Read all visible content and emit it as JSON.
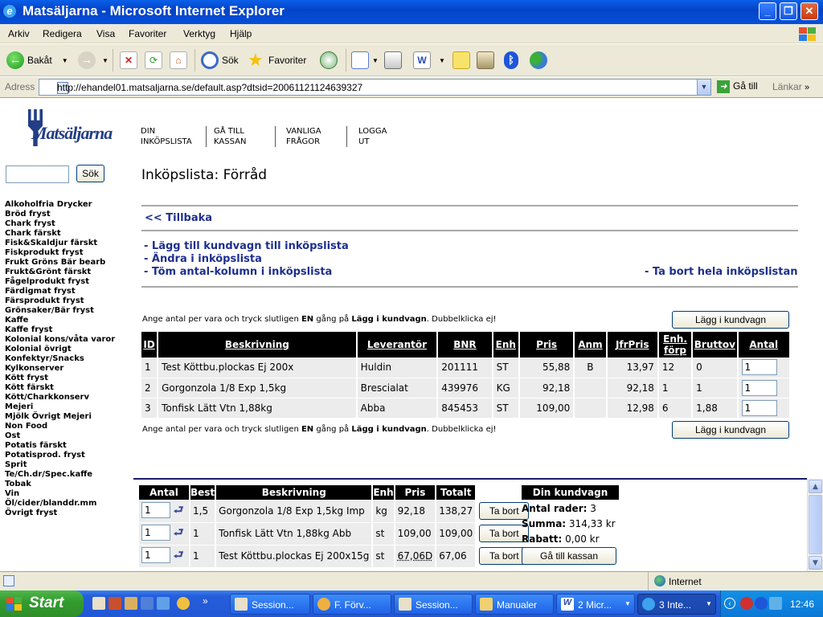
{
  "window": {
    "title": "Matsäljarna - Microsoft Internet Explorer",
    "min": "_",
    "max": "❐",
    "close": "✕"
  },
  "menu": [
    "Arkiv",
    "Redigera",
    "Visa",
    "Favoriter",
    "Verktyg",
    "Hjälp"
  ],
  "toolbar": {
    "back": "Bakåt",
    "search": "Sök",
    "favorites": "Favoriter"
  },
  "address": {
    "label": "Adress",
    "url": "http://ehandel01.matsaljarna.se/default.asp?dtsid=20061121124639327",
    "go": "Gå till",
    "links": "Länkar"
  },
  "site": {
    "logo": "Matsäljarna"
  },
  "topnav": [
    {
      "line1": "DIN",
      "line2": "INKÖPSLISTA"
    },
    {
      "line1": "GÅ TILL",
      "line2": "KASSAN"
    },
    {
      "line1": "VANLIGA",
      "line2": "FRÅGOR"
    },
    {
      "line1": "LOGGA",
      "line2": "UT"
    }
  ],
  "search": {
    "button": "Sök",
    "value": ""
  },
  "categories": [
    "Alkoholfria Drycker",
    "Bröd fryst",
    "Chark fryst",
    "Chark färskt",
    "Fisk&Skaldjur färskt",
    "Fiskprodukt fryst",
    "Frukt Gröns Bär bearb",
    "Frukt&Grönt färskt",
    "Fågelprodukt fryst",
    "Färdigmat fryst",
    "Färsprodukt fryst",
    "Grönsaker/Bär fryst",
    "Kaffe",
    "Kaffe fryst",
    "Kolonial kons/våta varor",
    "Kolonial övrigt",
    "Konfektyr/Snacks",
    "Kylkonserver",
    "Kött fryst",
    "Kött färskt",
    "Kött/Charkkonserv",
    "Mejeri",
    "Mjölk Övrigt Mejeri",
    "Non Food",
    "Ost",
    "Potatis färskt",
    "Potatisprod. fryst",
    "Sprit",
    "Te/Ch.dr/Spec.kaffe",
    "Tobak",
    "Vin",
    "Öl/cider/blanddr.mm",
    "Övrigt fryst"
  ],
  "main": {
    "heading": "Inköpslista: Förråd",
    "back": "<< Tillbaka",
    "actions": [
      "- Lägg till kundvagn till inköpslista",
      "- Ändra i inköpslista",
      "- Töm antal-kolumn i inköpslista"
    ],
    "delete_all": "- Ta bort hela inköpslistan",
    "instruction_pre": "Ange antal per vara och tryck slutligen",
    "instruction_en": "EN",
    "instruction_mid": "gång på",
    "instruction_btn": "Lägg i kundvagn",
    "instruction_post": ". Dubbelklicka ej!",
    "add_to_cart": "Lägg i kundvagn"
  },
  "list_table": {
    "headers": [
      "ID",
      "Beskrivning",
      "Leverantör",
      "BNR",
      "Enh",
      "Pris",
      "Anm",
      "JfrPris",
      "Enh.",
      "förp",
      "Bruttov",
      "Antal"
    ],
    "rows": [
      {
        "id": "1",
        "desc": "Test Köttbu.plockas Ej 200x",
        "lev": "Huldin",
        "bnr": "201111",
        "enh": "ST",
        "pris": "55,88",
        "anm": "B",
        "jfr": "13,97",
        "forp": "12",
        "brutto": "0",
        "antal": "1"
      },
      {
        "id": "2",
        "desc": "Gorgonzola 1/8 Exp 1,5kg",
        "lev": "Brescialat",
        "bnr": "439976",
        "enh": "KG",
        "pris": "92,18",
        "anm": "",
        "jfr": "92,18",
        "forp": "1",
        "brutto": "1",
        "antal": "1"
      },
      {
        "id": "3",
        "desc": "Tonfisk Lätt Vtn 1,88kg",
        "lev": "Abba",
        "bnr": "845453",
        "enh": "ST",
        "pris": "109,00",
        "anm": "",
        "jfr": "12,98",
        "forp": "6",
        "brutto": "1,88",
        "antal": "1"
      }
    ]
  },
  "cart_table": {
    "headers": [
      "Antal",
      "Best",
      "Beskrivning",
      "Enh",
      "Pris",
      "Totalt"
    ],
    "remove": "Ta bort",
    "rows": [
      {
        "antal": "1",
        "best": "1,5",
        "desc": "Gorgonzola 1/8 Exp 1,5kg Imp",
        "enh": "kg",
        "pris": "92,18",
        "tot": "138,27"
      },
      {
        "antal": "1",
        "best": "1",
        "desc": "Tonfisk Lätt Vtn 1,88kg Abb",
        "enh": "st",
        "pris": "109,00",
        "tot": "109,00"
      },
      {
        "antal": "1",
        "best": "1",
        "desc": "Test Köttbu.plockas Ej 200x15g",
        "enh": "st",
        "pris": "67,06D",
        "tot": "67,06"
      }
    ]
  },
  "cart_summary": {
    "title": "Din kundvagn",
    "rows_label": "Antal rader:",
    "rows_value": "3",
    "sum_label": "Summa:",
    "sum_value": "314,33 kr",
    "discount_label": "Rabatt:",
    "discount_value": "0,00 kr",
    "checkout": "Gå till kassan"
  },
  "status": {
    "zone": "Internet"
  },
  "taskbar": {
    "start": "Start",
    "tasks": [
      "Session...",
      "F. Förv...",
      "Session...",
      "Manualer",
      "2 Micr...",
      "3 Inte..."
    ],
    "clock": "12:46"
  }
}
